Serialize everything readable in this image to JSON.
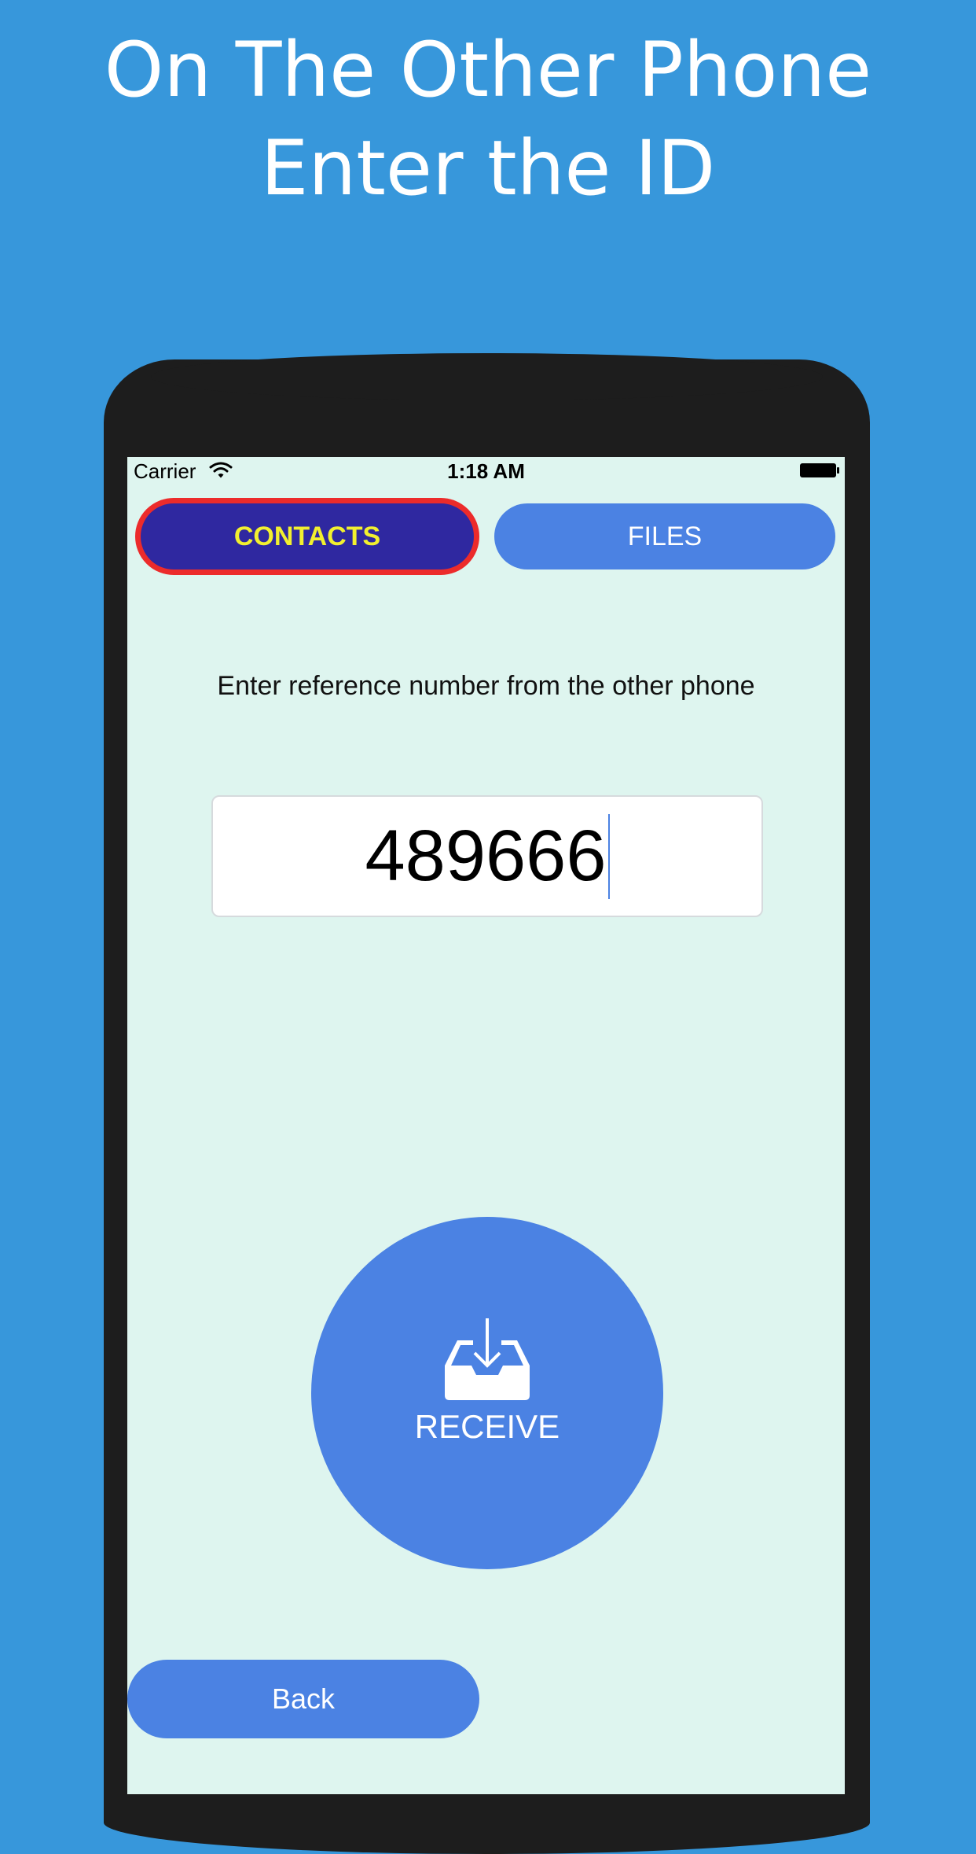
{
  "headline": {
    "line1": "On The Other Phone",
    "line2": "Enter the ID"
  },
  "status_bar": {
    "carrier": "Carrier",
    "time": "1:18 AM",
    "icons": [
      "wifi-icon",
      "battery-icon"
    ]
  },
  "tabs": [
    {
      "label": "CONTACTS",
      "selected": true
    },
    {
      "label": "FILES",
      "selected": false
    }
  ],
  "instruction": "Enter reference number from the other phone",
  "reference_input": {
    "value": "489666"
  },
  "receive": {
    "label": "RECEIVE",
    "icon": "inbox-download-icon"
  },
  "back": {
    "label": "Back"
  },
  "colors": {
    "page_background": "#3797db",
    "screen_background": "#def5ef",
    "button_blue": "#4b82e3",
    "selected_tab": "#2f28a0",
    "selected_tab_text": "#f2f02f",
    "selected_tab_border": "#ec2b2b",
    "phone_frame": "#1d1d1d"
  }
}
